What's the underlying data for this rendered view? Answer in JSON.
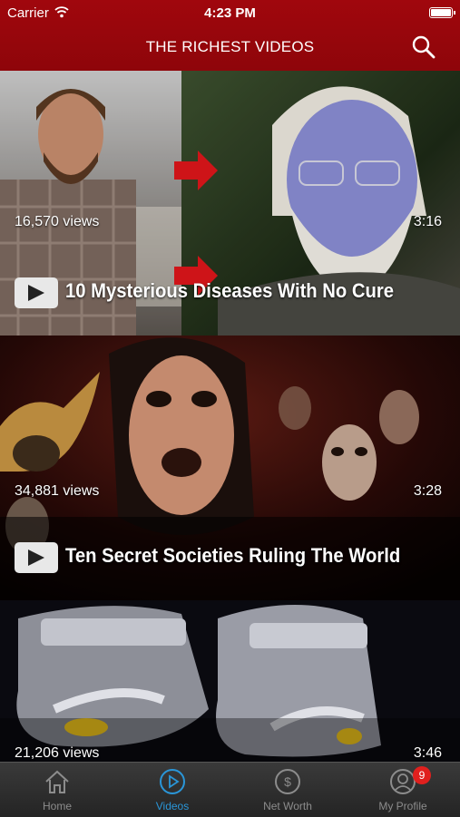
{
  "status_bar": {
    "carrier": "Carrier",
    "time": "4:23 PM"
  },
  "nav": {
    "title": "THE RICHEST VIDEOS",
    "search_icon": "search-icon"
  },
  "videos": [
    {
      "views": "16,570 views",
      "duration": "3:16",
      "title": "10 Mysterious Diseases With No Cure"
    },
    {
      "views": "34,881 views",
      "duration": "3:28",
      "title": "Ten Secret Societies Ruling The World"
    },
    {
      "views": "21,206 views",
      "duration": "3:46",
      "title": ""
    }
  ],
  "tabbar": {
    "tabs": [
      {
        "label": "Home",
        "icon": "home-icon"
      },
      {
        "label": "Videos",
        "icon": "play-circle-icon"
      },
      {
        "label": "Net Worth",
        "icon": "dollar-circle-icon"
      },
      {
        "label": "My Profile",
        "icon": "profile-icon",
        "badge": "9"
      }
    ],
    "active": "Videos"
  },
  "colors": {
    "header": "#9a060c",
    "tab_active": "#2a96d8",
    "tab_inactive": "#8c8c8c",
    "badge": "#e0201e"
  }
}
